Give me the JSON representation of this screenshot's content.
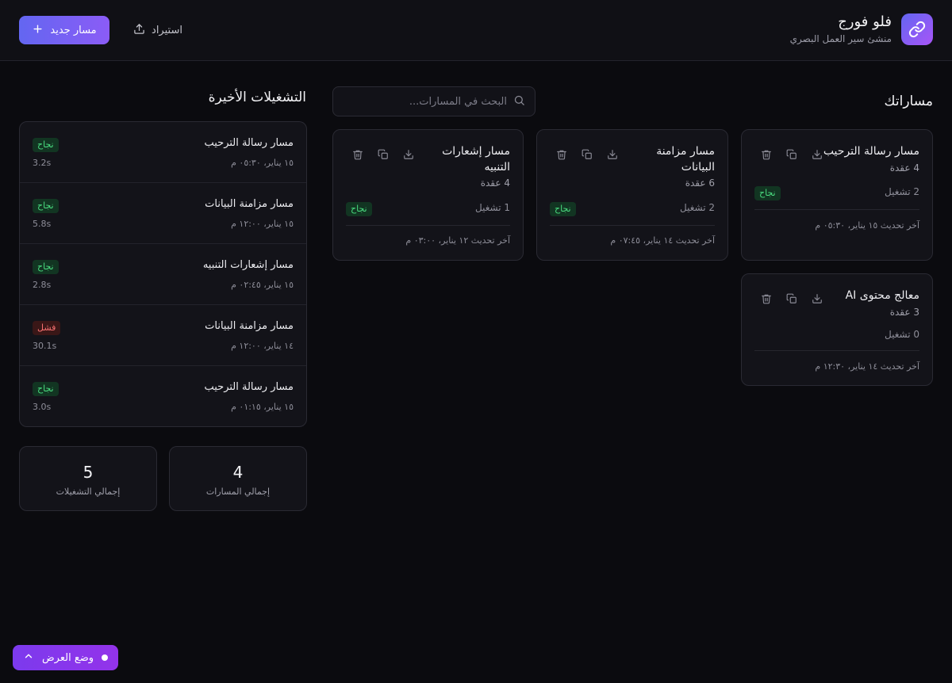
{
  "app": {
    "title": "فلو فورج",
    "subtitle": "منشئ سير العمل البصري"
  },
  "toolbar": {
    "new_label": "مسار جديد",
    "import_label": "استيراد"
  },
  "workflows": {
    "heading": "مساراتك",
    "search_placeholder": "البحث في المسارات...",
    "cards": [
      {
        "title": "مسار رسالة الترحيب",
        "nodes": "4 عقدة",
        "runs": "2 تشغيل",
        "status": "نجاح",
        "updated": "آخر تحديث ١٥ يناير، ٠٥:٣٠ م"
      },
      {
        "title": "مسار مزامنة البيانات",
        "nodes": "6 عقدة",
        "runs": "2 تشغيل",
        "status": "نجاح",
        "updated": "آخر تحديث ١٤ يناير، ٠٧:٤٥ م"
      },
      {
        "title": "مسار إشعارات التنبيه",
        "nodes": "4 عقدة",
        "runs": "1 تشغيل",
        "status": "نجاح",
        "updated": "آخر تحديث ١٢ يناير، ٠٣:٠٠ م"
      },
      {
        "title": "معالج محتوى AI",
        "nodes": "3 عقدة",
        "runs": "0 تشغيل",
        "status": "",
        "updated": "آخر تحديث ١٤ يناير، ١٢:٣٠ م"
      }
    ]
  },
  "recent_runs": {
    "heading": "التشغيلات الأخيرة",
    "items": [
      {
        "name": "مسار رسالة الترحيب",
        "time": "١٥ يناير، ٠٥:٣٠ م",
        "status": "نجاح",
        "duration": "3.2s"
      },
      {
        "name": "مسار مزامنة البيانات",
        "time": "١٥ يناير، ١٢:٠٠ م",
        "status": "نجاح",
        "duration": "5.8s"
      },
      {
        "name": "مسار إشعارات التنبيه",
        "time": "١٥ يناير، ٠٢:٤٥ م",
        "status": "نجاح",
        "duration": "2.8s"
      },
      {
        "name": "مسار مزامنة البيانات",
        "time": "١٤ يناير، ١٢:٠٠ م",
        "status": "فشل",
        "duration": "30.1s"
      },
      {
        "name": "مسار رسالة الترحيب",
        "time": "١٥ يناير، ٠١:١٥ م",
        "status": "نجاح",
        "duration": "3.0s"
      }
    ]
  },
  "stats": {
    "workflows_value": "4",
    "workflows_label": "إجمالي المسارات",
    "runs_value": "5",
    "runs_label": "إجمالي التشغيلات"
  },
  "view_mode": {
    "label": "وضع العرض"
  },
  "colors": {
    "accent": "#6366f1",
    "accent_purple": "#8b5cf6",
    "success": "#4ade80",
    "failure": "#f87171"
  }
}
